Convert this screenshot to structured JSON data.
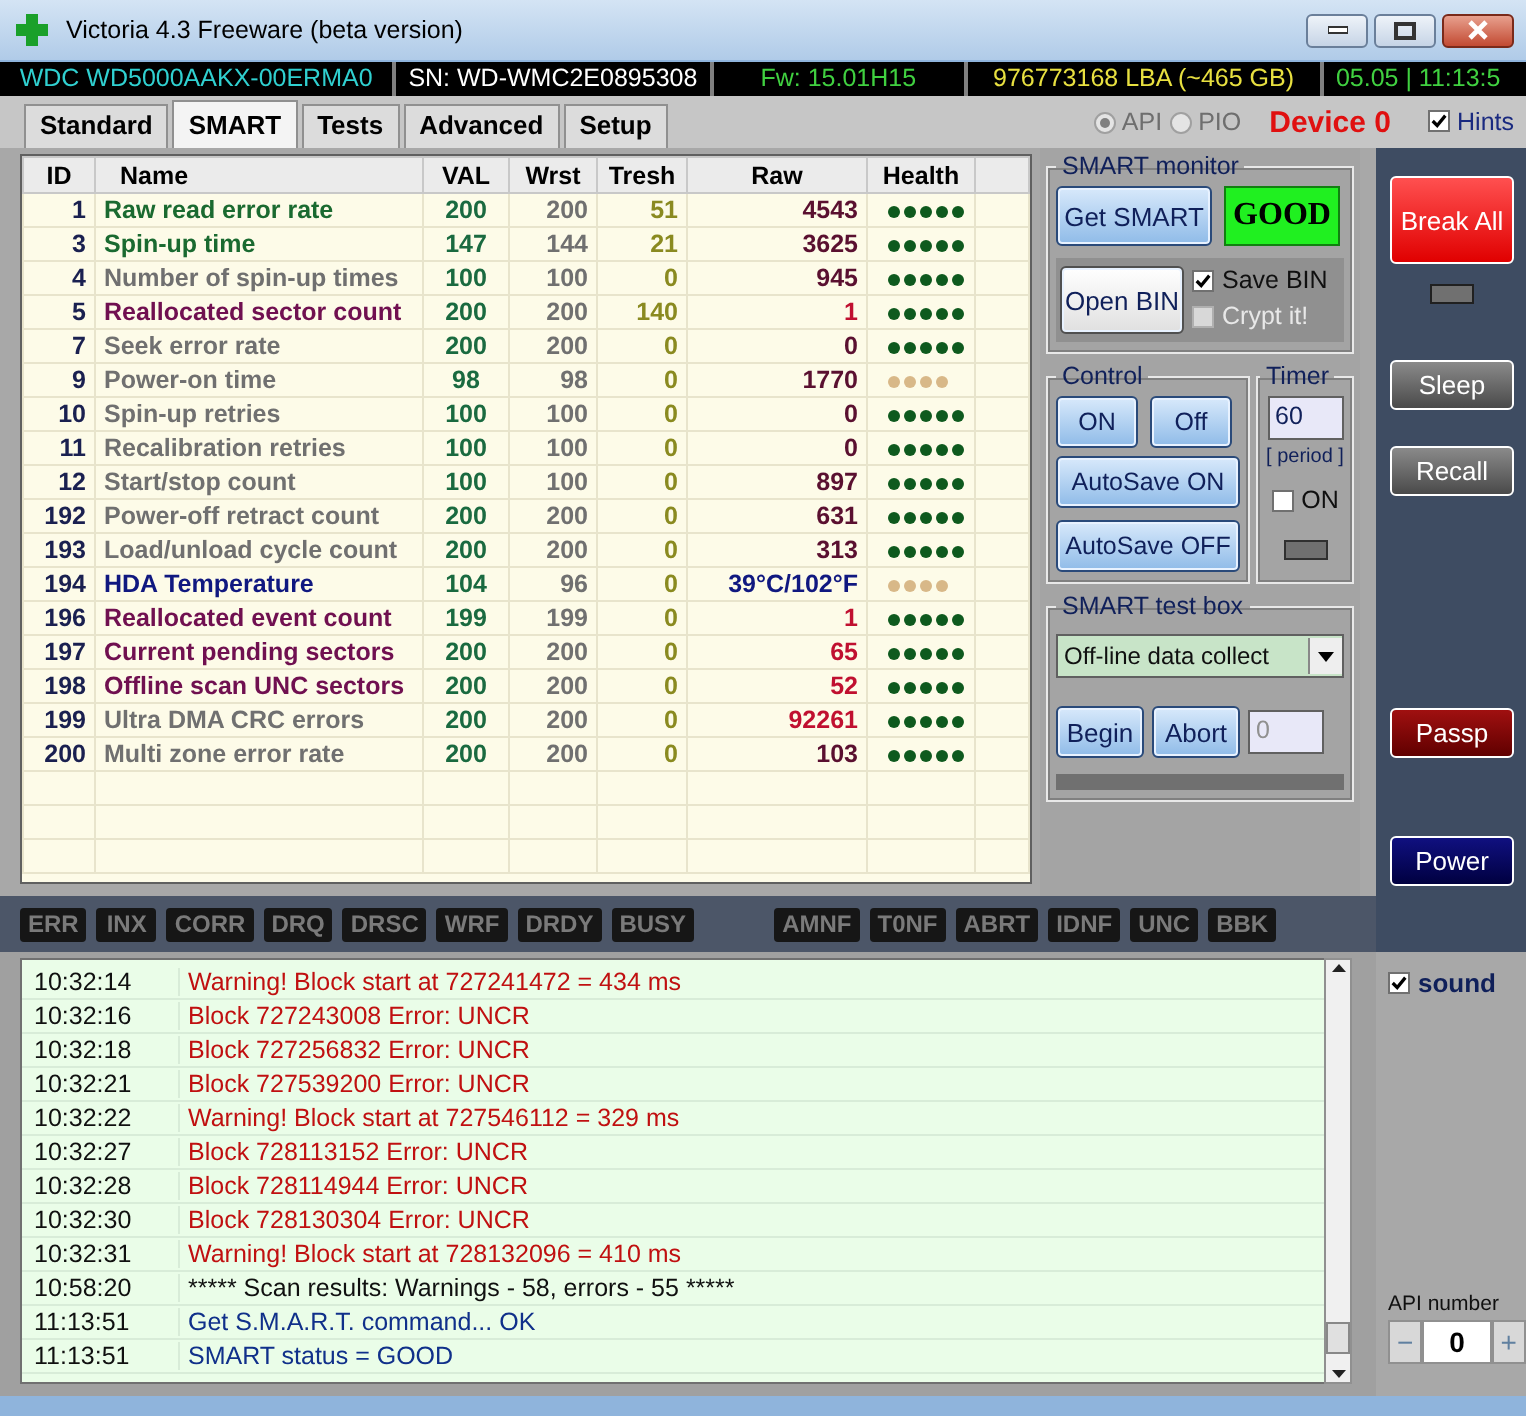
{
  "window": {
    "title": "Victoria 4.3 Freeware (beta version)"
  },
  "info_strip": {
    "model": "WDC WD5000AAKX-00ERMA0",
    "serial": "SN: WD-WMC2E0895308",
    "firmware": "Fw: 15.01H15",
    "capacity": "976773168 LBA (~465 GB)",
    "clock": "05.05 | 11:13:5"
  },
  "tabs": [
    {
      "label": "Standard",
      "selected": false
    },
    {
      "label": "SMART",
      "selected": true
    },
    {
      "label": "Tests",
      "selected": false
    },
    {
      "label": "Advanced",
      "selected": false
    },
    {
      "label": "Setup",
      "selected": false
    }
  ],
  "interface": {
    "disabled": true,
    "options": [
      {
        "label": "API",
        "selected": true
      },
      {
        "label": "PIO",
        "selected": false
      }
    ]
  },
  "device": "Device 0",
  "hints": {
    "label": "Hints",
    "checked": true
  },
  "smart_table": {
    "columns": [
      "ID",
      "Name",
      "VAL",
      "Wrst",
      "Tresh",
      "Raw",
      "Health"
    ],
    "rows": [
      {
        "id": "1",
        "name": "Raw read error rate",
        "kind": "key",
        "val": "200",
        "wrst": "200",
        "tresh": "51",
        "raw": {
          "text": "4543",
          "color": "#5a1030"
        },
        "stars": 5
      },
      {
        "id": "3",
        "name": "Spin-up time",
        "kind": "key",
        "val": "147",
        "wrst": "144",
        "tresh": "21",
        "raw": {
          "text": "3625",
          "color": "#5a1030"
        },
        "stars": 5
      },
      {
        "id": "4",
        "name": "Number of spin-up times",
        "kind": "normal",
        "val": "100",
        "wrst": "100",
        "tresh": "0",
        "raw": {
          "text": "945",
          "color": "#5a1030"
        },
        "stars": 5
      },
      {
        "id": "5",
        "name": "Reallocated sector count",
        "kind": "critical",
        "val": "200",
        "wrst": "200",
        "tresh": "140",
        "raw": {
          "text": "1",
          "color": "#c01030"
        },
        "stars": 5
      },
      {
        "id": "7",
        "name": "Seek error rate",
        "kind": "normal",
        "val": "200",
        "wrst": "200",
        "tresh": "0",
        "raw": {
          "text": "0",
          "color": "#5a1030"
        },
        "stars": 5
      },
      {
        "id": "9",
        "name": "Power-on time",
        "kind": "normal",
        "val": "98",
        "wrst": "98",
        "tresh": "0",
        "raw": {
          "text": "1770",
          "color": "#5a1030"
        },
        "stars": 4
      },
      {
        "id": "10",
        "name": "Spin-up retries",
        "kind": "normal",
        "val": "100",
        "wrst": "100",
        "tresh": "0",
        "raw": {
          "text": "0",
          "color": "#5a1030"
        },
        "stars": 5
      },
      {
        "id": "11",
        "name": "Recalibration retries",
        "kind": "normal",
        "val": "100",
        "wrst": "100",
        "tresh": "0",
        "raw": {
          "text": "0",
          "color": "#5a1030"
        },
        "stars": 5
      },
      {
        "id": "12",
        "name": "Start/stop count",
        "kind": "normal",
        "val": "100",
        "wrst": "100",
        "tresh": "0",
        "raw": {
          "text": "897",
          "color": "#5a1030"
        },
        "stars": 5
      },
      {
        "id": "192",
        "name": "Power-off retract count",
        "kind": "normal",
        "val": "200",
        "wrst": "200",
        "tresh": "0",
        "raw": {
          "text": "631",
          "color": "#5a1030"
        },
        "stars": 5
      },
      {
        "id": "193",
        "name": "Load/unload cycle count",
        "kind": "normal",
        "val": "200",
        "wrst": "200",
        "tresh": "0",
        "raw": {
          "text": "313",
          "color": "#5a1030"
        },
        "stars": 5
      },
      {
        "id": "194",
        "name": "HDA Temperature",
        "kind": "temp",
        "val": "104",
        "wrst": "96",
        "tresh": "0",
        "raw": {
          "text": "39°C/102°F",
          "color": "#101880"
        },
        "stars": 4
      },
      {
        "id": "196",
        "name": "Reallocated event count",
        "kind": "critical",
        "val": "199",
        "wrst": "199",
        "tresh": "0",
        "raw": {
          "text": "1",
          "color": "#c01030"
        },
        "stars": 5
      },
      {
        "id": "197",
        "name": "Current pending sectors",
        "kind": "critical",
        "val": "200",
        "wrst": "200",
        "tresh": "0",
        "raw": {
          "text": "65",
          "color": "#c01030"
        },
        "stars": 5
      },
      {
        "id": "198",
        "name": "Offline scan UNC sectors",
        "kind": "critical",
        "val": "200",
        "wrst": "200",
        "tresh": "0",
        "raw": {
          "text": "52",
          "color": "#c01030"
        },
        "stars": 5
      },
      {
        "id": "199",
        "name": "Ultra DMA CRC errors",
        "kind": "normal",
        "val": "200",
        "wrst": "200",
        "tresh": "0",
        "raw": {
          "text": "92261",
          "color": "#c01030"
        },
        "stars": 5
      },
      {
        "id": "200",
        "name": "Multi zone error rate",
        "kind": "normal",
        "val": "200",
        "wrst": "200",
        "tresh": "0",
        "raw": {
          "text": "103",
          "color": "#5a1030"
        },
        "stars": 5
      }
    ]
  },
  "smart_monitor": {
    "title": "SMART monitor",
    "get_button": "Get SMART",
    "status": "GOOD",
    "open_button": "Open BIN",
    "save_bin": {
      "label": "Save BIN",
      "checked": true
    },
    "crypt": {
      "label": "Crypt it!",
      "checked": false,
      "disabled": true
    }
  },
  "control": {
    "title": "Control",
    "buttons": [
      "ON",
      "Off",
      "AutoSave ON",
      "AutoSave OFF"
    ]
  },
  "timer": {
    "title": "Timer",
    "value": "60",
    "caption": "[ period ]",
    "on_checkbox": {
      "label": "ON",
      "checked": false
    }
  },
  "test_box": {
    "title": "SMART test box",
    "select": "Off-line data collect",
    "buttons": [
      "Begin",
      "Abort"
    ],
    "counter": "0",
    "progress": {
      "level": 0
    }
  },
  "actions": [
    {
      "label": "Break All",
      "kind": "danger"
    },
    {
      "label": "Sleep",
      "kind": "gray"
    },
    {
      "label": "Recall",
      "kind": "gray"
    },
    {
      "label": "Passp",
      "kind": "maroon"
    },
    {
      "label": "Power",
      "kind": "navy"
    }
  ],
  "indicators": {
    "left": [
      "ERR",
      "INX",
      "CORR",
      "DRQ",
      "DRSC",
      "WRF",
      "DRDY",
      "BUSY"
    ],
    "right": [
      "AMNF",
      "T0NF",
      "ABRT",
      "IDNF",
      "UNC",
      "BBK"
    ]
  },
  "log": [
    {
      "time": "10:32:14",
      "text": "Warning! Block start at 727241472 = 434 ms",
      "kind": "error"
    },
    {
      "time": "10:32:16",
      "text": "Block 727243008 Error: UNCR",
      "kind": "error"
    },
    {
      "time": "10:32:18",
      "text": "Block 727256832 Error: UNCR",
      "kind": "error"
    },
    {
      "time": "10:32:21",
      "text": "Block 727539200 Error: UNCR",
      "kind": "error"
    },
    {
      "time": "10:32:22",
      "text": "Warning! Block start at 727546112 = 329 ms",
      "kind": "error"
    },
    {
      "time": "10:32:27",
      "text": "Block 728113152 Error: UNCR",
      "kind": "error"
    },
    {
      "time": "10:32:28",
      "text": "Block 728114944 Error: UNCR",
      "kind": "error"
    },
    {
      "time": "10:32:30",
      "text": "Block 728130304 Error: UNCR",
      "kind": "error"
    },
    {
      "time": "10:32:31",
      "text": "Warning! Block start at 728132096 = 410 ms",
      "kind": "error"
    },
    {
      "time": "10:58:20",
      "text": "***** Scan results: Warnings - 58, errors - 55 *****",
      "kind": "plain"
    },
    {
      "time": "11:13:51",
      "text": "Get S.M.A.R.T. command... OK",
      "kind": "info"
    },
    {
      "time": "11:13:51",
      "text": "SMART status = GOOD",
      "kind": "info"
    }
  ],
  "sound": {
    "label": "sound",
    "checked": true
  },
  "api_number": {
    "label": "API number",
    "minus": "−",
    "value": "0",
    "plus": "+"
  }
}
